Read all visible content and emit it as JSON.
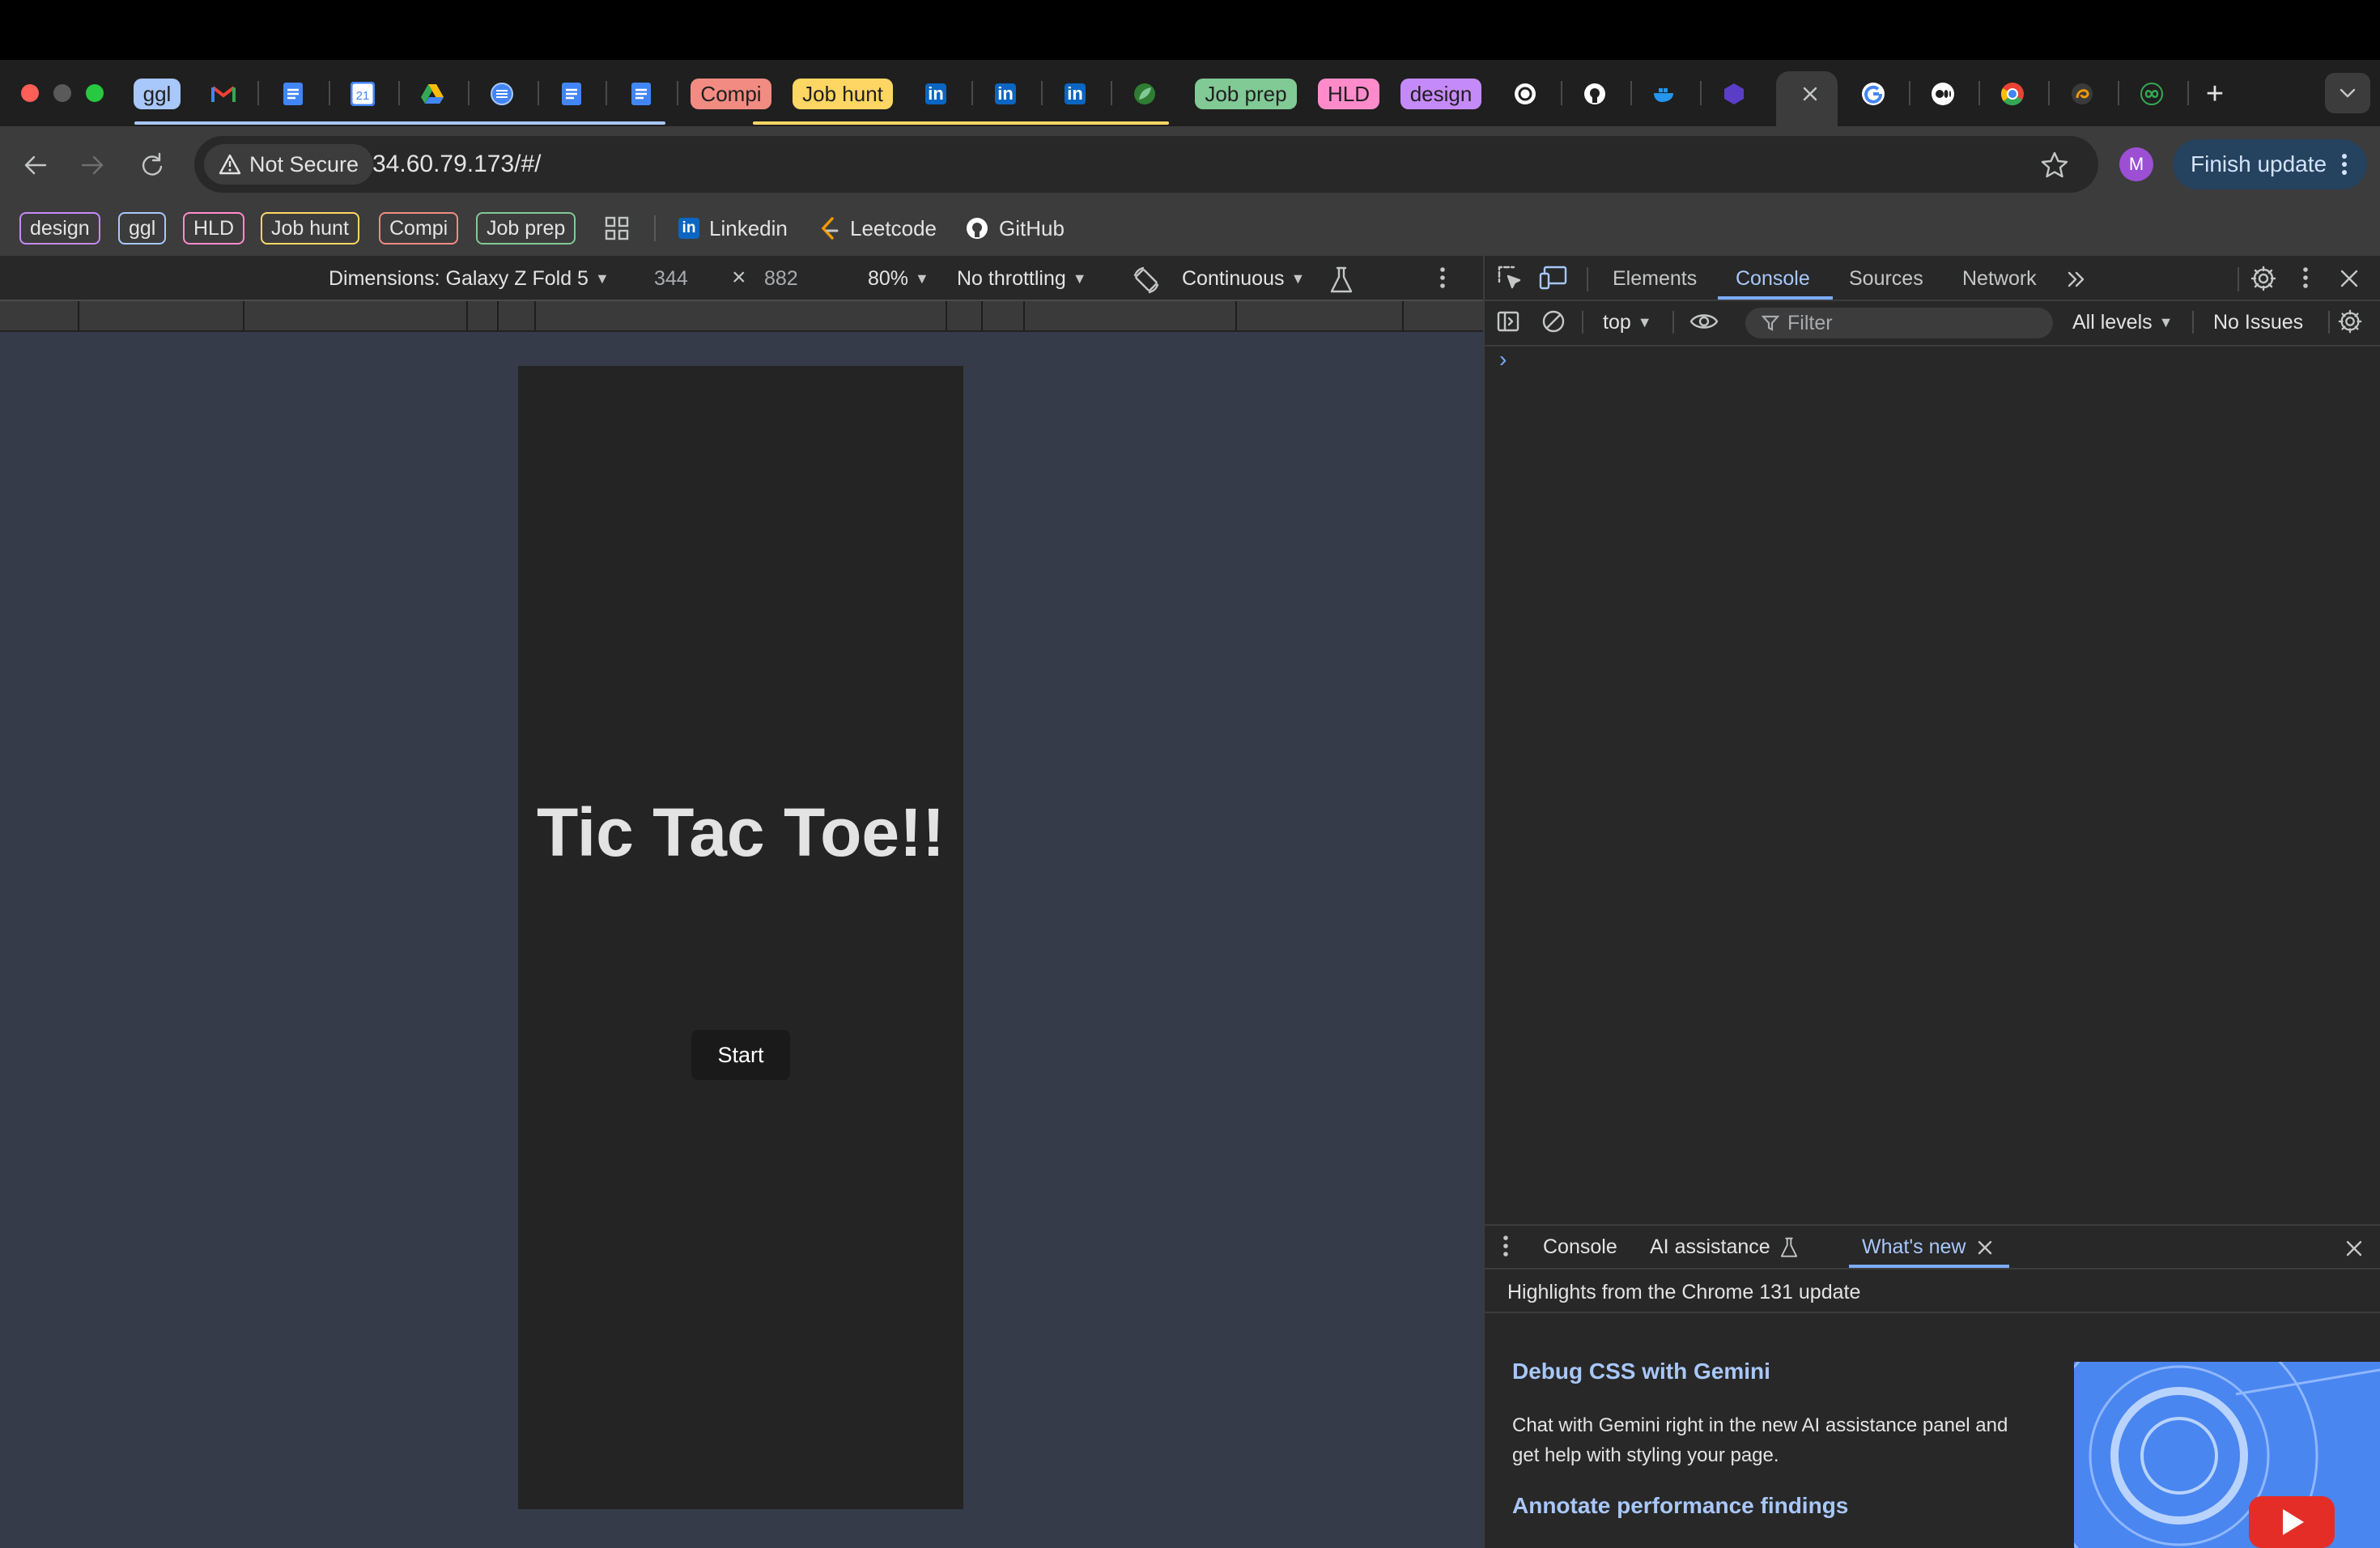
{
  "browser": {
    "tabs": [
      {
        "kind": "group",
        "label": "ggl",
        "color": "#a8c7fa"
      },
      {
        "kind": "fav",
        "icon": "gmail-icon"
      },
      {
        "kind": "fav",
        "icon": "docs-icon"
      },
      {
        "kind": "fav",
        "icon": "calendar-icon",
        "text": "21"
      },
      {
        "kind": "fav",
        "icon": "drive-icon"
      },
      {
        "kind": "fav",
        "icon": "circle-lines-icon"
      },
      {
        "kind": "fav",
        "icon": "docs-icon"
      },
      {
        "kind": "fav",
        "icon": "docs-icon"
      },
      {
        "kind": "group",
        "label": "Compi",
        "color": "#f28b82"
      },
      {
        "kind": "group",
        "label": "Job hunt",
        "color": "#fdd663"
      },
      {
        "kind": "fav",
        "icon": "linkedin-icon",
        "text": "in"
      },
      {
        "kind": "fav",
        "icon": "linkedin-icon",
        "text": "in"
      },
      {
        "kind": "fav",
        "icon": "linkedin-icon",
        "text": "in"
      },
      {
        "kind": "fav",
        "icon": "leaf-icon"
      },
      {
        "kind": "group",
        "label": "Job prep",
        "color": "#81c995"
      },
      {
        "kind": "group",
        "label": "HLD",
        "color": "#ff8bcb"
      },
      {
        "kind": "group",
        "label": "design",
        "color": "#c58af9"
      },
      {
        "kind": "fav",
        "icon": "openai-icon"
      },
      {
        "kind": "fav",
        "icon": "github-icon"
      },
      {
        "kind": "fav",
        "icon": "docker-icon"
      },
      {
        "kind": "fav",
        "icon": "hex-icon"
      },
      {
        "kind": "active",
        "icon": "close-icon"
      },
      {
        "kind": "fav",
        "icon": "google-icon"
      },
      {
        "kind": "fav",
        "icon": "medium-icon"
      },
      {
        "kind": "fav",
        "icon": "chrome-icon"
      },
      {
        "kind": "fav",
        "icon": "swirl-icon"
      },
      {
        "kind": "fav",
        "icon": "infinity-icon"
      }
    ],
    "new_tab_symbol": "+",
    "security_label": "Not Secure",
    "url": "34.60.79.173/#/",
    "profile_initial": "M",
    "finish_update_label": "Finish update",
    "bookmarks": [
      {
        "label": "design",
        "color": "#c58af9"
      },
      {
        "label": "ggl",
        "color": "#a8c7fa"
      },
      {
        "label": "HLD",
        "color": "#ff8bcb"
      },
      {
        "label": "Job hunt",
        "color": "#fdd663"
      },
      {
        "label": "Compi",
        "color": "#f28b82"
      },
      {
        "label": "Job prep",
        "color": "#81c995"
      }
    ],
    "bookmark_links": [
      {
        "label": "Linkedin",
        "icon": "linkedin-icon"
      },
      {
        "label": "Leetcode",
        "icon": "leetcode-icon"
      },
      {
        "label": "GitHub",
        "icon": "github-icon"
      }
    ]
  },
  "device_toolbar": {
    "dimensions_label": "Dimensions: Galaxy Z Fold 5",
    "width": "344",
    "times": "×",
    "height": "882",
    "zoom": "80%",
    "throttling": "No throttling",
    "mode": "Continuous"
  },
  "app": {
    "title": "Tic Tac Toe!!",
    "start_label": "Start"
  },
  "devtools": {
    "tabs": [
      "Elements",
      "Console",
      "Sources",
      "Network"
    ],
    "active_tab": "Console",
    "context": "top",
    "filter_placeholder": "Filter",
    "levels": "All levels",
    "issues": "No Issues",
    "prompt": "›",
    "drawer": {
      "tabs": [
        "Console",
        "AI assistance",
        "What's new"
      ],
      "active": "What's new",
      "highlights": "Highlights from the Chrome 131 update",
      "items": [
        {
          "title": "Debug CSS with Gemini",
          "body": "Chat with Gemini right in the new AI assistance panel and get help with styling your page."
        },
        {
          "title": "Annotate performance findings",
          "body": ""
        }
      ]
    }
  },
  "colors": {
    "accent": "#7cacf8",
    "finish_update_bg": "#25425e",
    "viewport_bg": "#353b48",
    "device_bg": "#242424"
  }
}
